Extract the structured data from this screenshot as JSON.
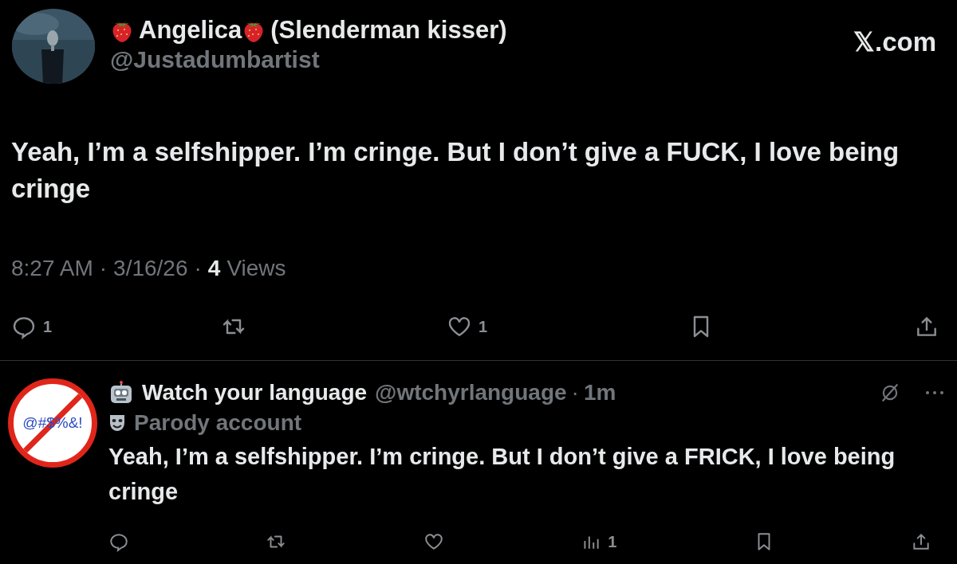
{
  "post": {
    "name_parts": [
      "Angelica",
      "(Slenderman kisser)"
    ],
    "handle": "@Justadumbartist",
    "site": "𝕏.com",
    "text": "Yeah, I’m a selfshipper. I’m cringe. But I don’t give a FUCK, I love being cringe",
    "time": "8:27 AM",
    "sep": "·",
    "date": "3/16/26",
    "sep2": "·",
    "views_count": "4",
    "views_label": "Views",
    "actions": [
      {
        "kind": "reply",
        "count": "1"
      },
      {
        "kind": "repost"
      },
      {
        "kind": "like",
        "count": "1"
      },
      {
        "kind": "bookmark"
      },
      {
        "kind": "share"
      }
    ]
  },
  "reply": {
    "avatar_text": "@#$%&!",
    "name": "Watch your language",
    "handle": "@wtchyrlanguage",
    "sep": "·",
    "age": "1m",
    "label": "Parody account",
    "text": "Yeah, I’m a selfshipper. I’m cringe. But I don’t give a FRICK, I love being cringe",
    "actions": [
      {
        "kind": "reply"
      },
      {
        "kind": "repost"
      },
      {
        "kind": "like"
      },
      {
        "kind": "views",
        "count": "1"
      },
      {
        "kind": "bookmark"
      },
      {
        "kind": "share"
      }
    ]
  }
}
